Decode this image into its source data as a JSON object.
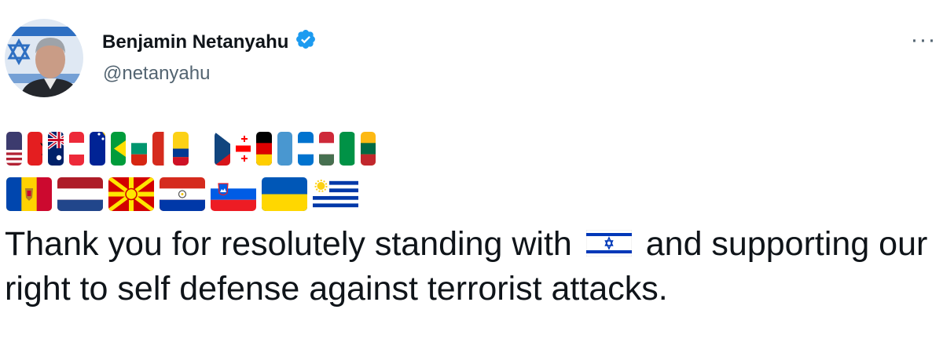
{
  "author": {
    "name": "Benjamin Netanyahu",
    "handle": "@netanyahu",
    "verified": true,
    "avatar_icon": "profile-photo"
  },
  "menu": {
    "more_label": "···"
  },
  "flags_row1": [
    "us-flag",
    "albania-flag",
    "australia-flag",
    "austria-flag",
    "bosnia-flag",
    "brazil-flag",
    "bulgaria-flag",
    "canada-flag",
    "colombia-flag",
    "cyprus-flag",
    "czechia-flag",
    "georgia-flag",
    "germany-flag",
    "guatemala-flag",
    "honduras-flag",
    "hungary-flag",
    "italy-flag",
    "lithuania-flag"
  ],
  "flags_row2": [
    "moldova-flag",
    "netherlands-flag",
    "north-macedonia-flag",
    "paraguay-flag",
    "slovenia-flag",
    "ukraine-flag",
    "uruguay-flag"
  ],
  "tweet": {
    "text_part1": "Thank you for resolutely standing with",
    "inline_icon": "israel-flag",
    "text_part2": "and supporting our right to self defense against terrorist attacks."
  },
  "colors": {
    "verified_blue": "#1d9bf0",
    "text": "#0f1419",
    "muted": "#536471"
  }
}
